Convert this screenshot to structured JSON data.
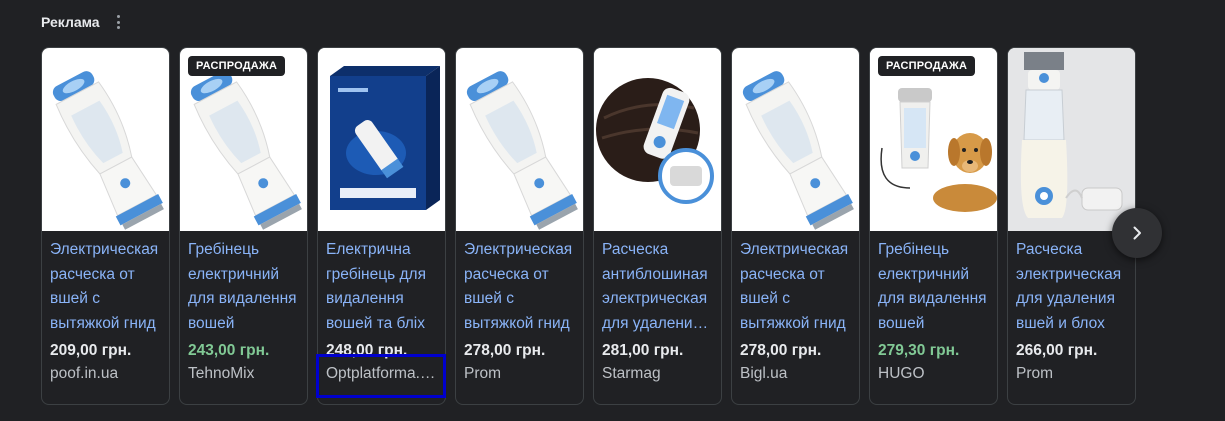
{
  "header": {
    "title": "Реклама",
    "more_icon": "more-vert-icon"
  },
  "cards": [
    {
      "title": "Электрическая расческа от вшей с вытяжкой гнид",
      "price": "209,00 грн.",
      "store": "poof.in.ua",
      "badge": "",
      "sale": false,
      "image": "lice-comb"
    },
    {
      "title": "Гребінець електричний для видалення вошей",
      "price": "243,00 грн.",
      "store": "TehnoMix",
      "badge": "РАСПРОДАЖА",
      "sale": true,
      "image": "lice-comb"
    },
    {
      "title": "Електрична гребінець для видалення вошей та бліх",
      "price": "248,00 грн.",
      "store": "Optplatforma.com.ua",
      "badge": "",
      "sale": false,
      "image": "product-box"
    },
    {
      "title": "Электрическая расческа от вшей с вытяжкой гнид",
      "price": "278,00 грн.",
      "store": "Prom",
      "badge": "",
      "sale": false,
      "image": "lice-comb"
    },
    {
      "title": "Расческа антиблошиная электрическая для удаления вшей",
      "price": "281,00 грн.",
      "store": "Starmag",
      "badge": "",
      "sale": false,
      "image": "hair-demo"
    },
    {
      "title": "Электрическая расческа от вшей с вытяжкой гнид",
      "price": "278,00 грн.",
      "store": "Bigl.ua",
      "badge": "",
      "sale": false,
      "image": "lice-comb"
    },
    {
      "title": "Гребінець електричний для видалення вошей",
      "price": "279,30 грн.",
      "store": "HUGO",
      "badge": "РАСПРОДАЖА",
      "sale": true,
      "image": "comb-dog"
    },
    {
      "title": "Расческа электрическая для удаления вшей и блох",
      "price": "266,00 грн.",
      "store": "Prom",
      "badge": "",
      "sale": false,
      "image": "tall-comb"
    }
  ],
  "next_button": {
    "icon": "chevron-right-icon"
  }
}
